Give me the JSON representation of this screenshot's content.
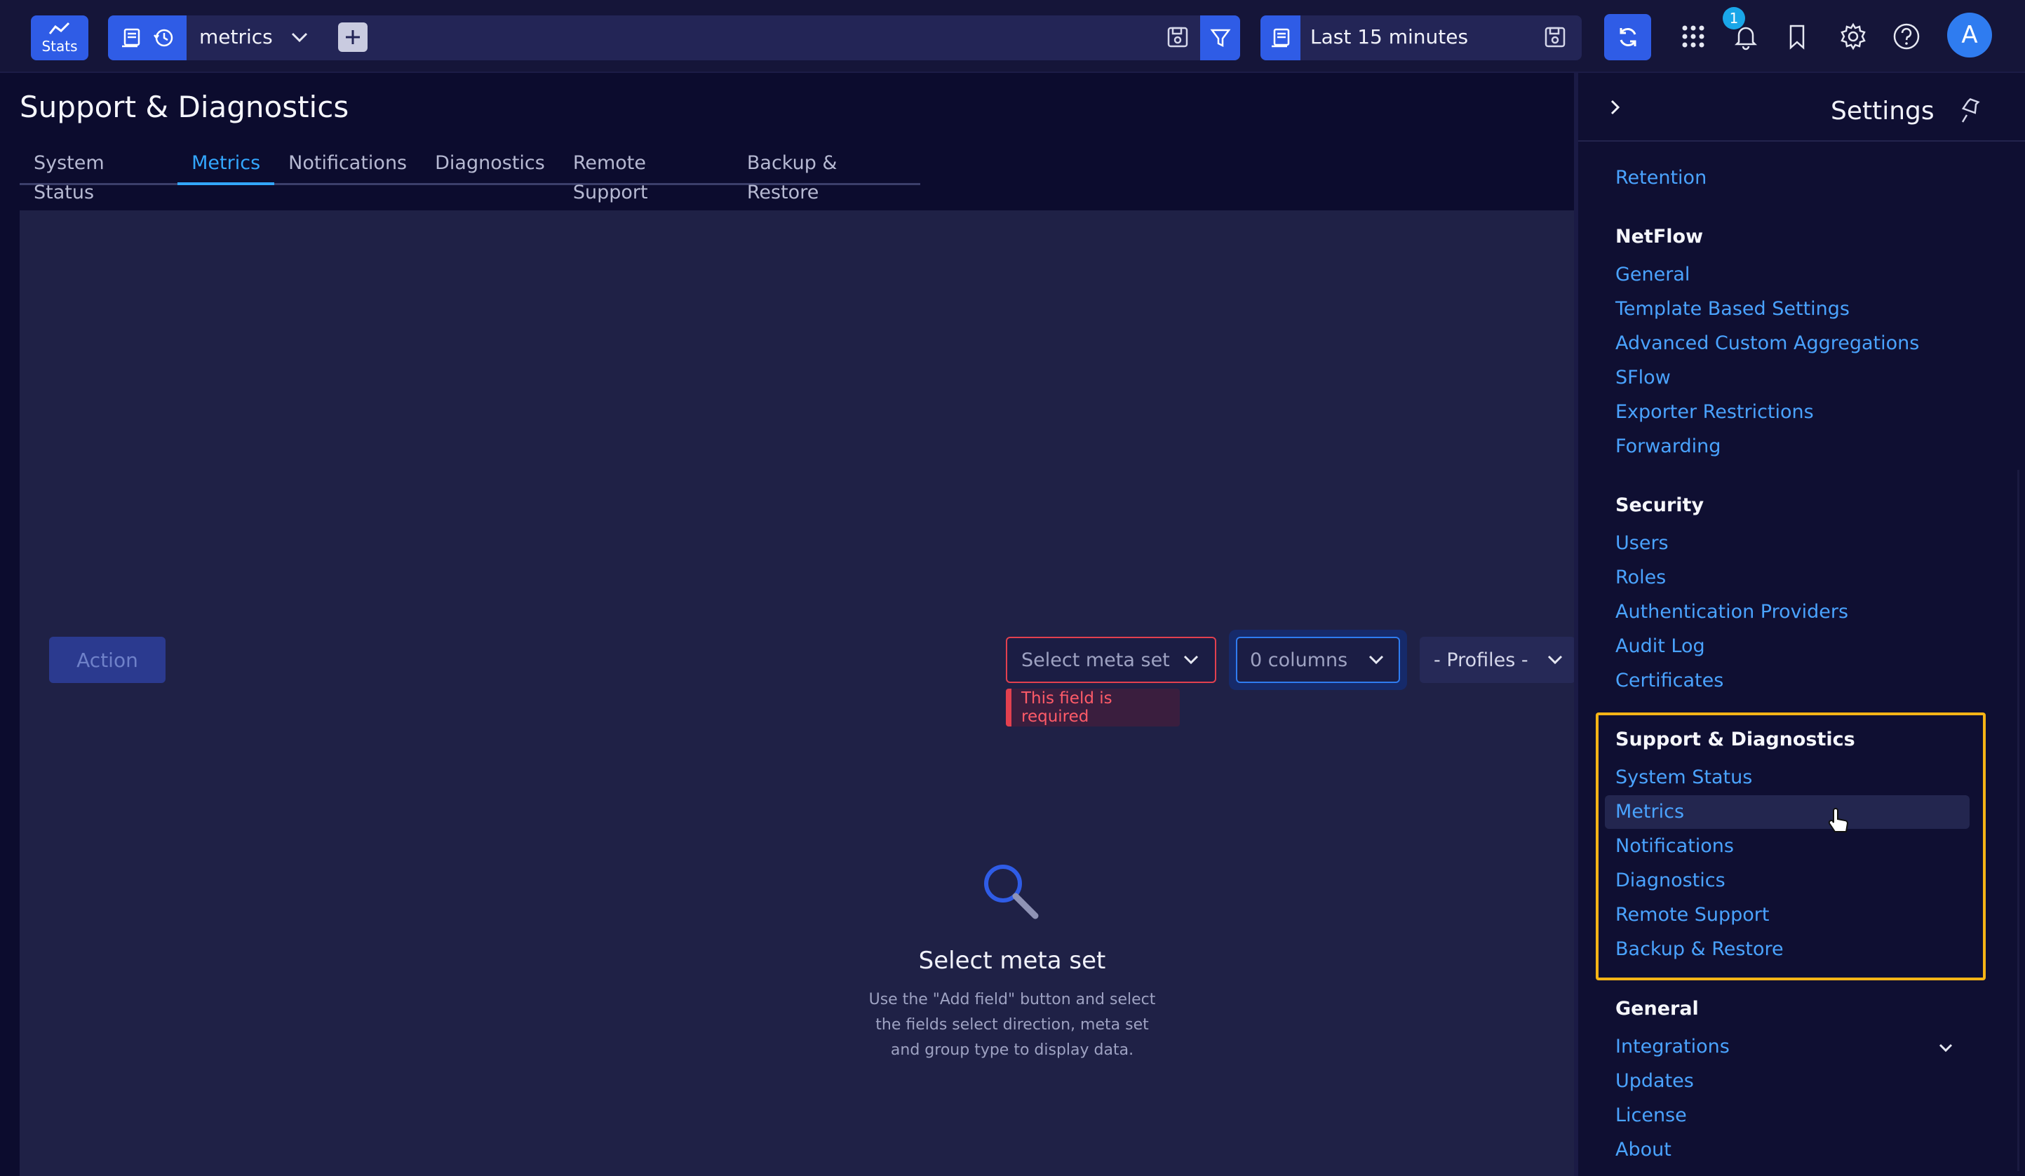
{
  "topbar": {
    "stats_label": "Stats",
    "query_name": "metrics",
    "time_range": "Last 15 minutes",
    "notification_count": "1",
    "avatar_initial": "A"
  },
  "page": {
    "title": "Support & Diagnostics",
    "tabs": [
      {
        "label": "System Status",
        "active": false
      },
      {
        "label": "Metrics",
        "active": true
      },
      {
        "label": "Notifications",
        "active": false
      },
      {
        "label": "Diagnostics",
        "active": false
      },
      {
        "label": "Remote Support",
        "active": false
      },
      {
        "label": "Backup & Restore",
        "active": false
      }
    ]
  },
  "controls": {
    "action_label": "Action",
    "meta_set_placeholder": "Select meta set",
    "required_message": "This field is required",
    "columns_label": "0 columns",
    "profiles_label": "- Profiles -"
  },
  "empty_state": {
    "title": "Select meta set",
    "description_lines": [
      "Use the \"Add field\" button and select",
      "the fields select direction, meta set",
      "and group type to display data."
    ]
  },
  "settings": {
    "title": "Settings",
    "retention_link": "Retention",
    "netflow": {
      "heading": "NetFlow",
      "items": [
        "General",
        "Template Based Settings",
        "Advanced Custom Aggregations",
        "SFlow",
        "Exporter Restrictions",
        "Forwarding"
      ]
    },
    "security": {
      "heading": "Security",
      "items": [
        "Users",
        "Roles",
        "Authentication Providers",
        "Audit Log",
        "Certificates"
      ]
    },
    "support": {
      "heading": "Support & Diagnostics",
      "items": [
        "System Status",
        "Metrics",
        "Notifications",
        "Diagnostics",
        "Remote Support",
        "Backup & Restore"
      ],
      "hovered": "Metrics"
    },
    "general": {
      "heading": "General",
      "items": [
        "Integrations",
        "Updates",
        "License",
        "About"
      ]
    }
  },
  "colors": {
    "accent": "#2f5ce6",
    "link": "#4aa3ff",
    "error": "#e2404f",
    "highlight": "#f6b416"
  }
}
